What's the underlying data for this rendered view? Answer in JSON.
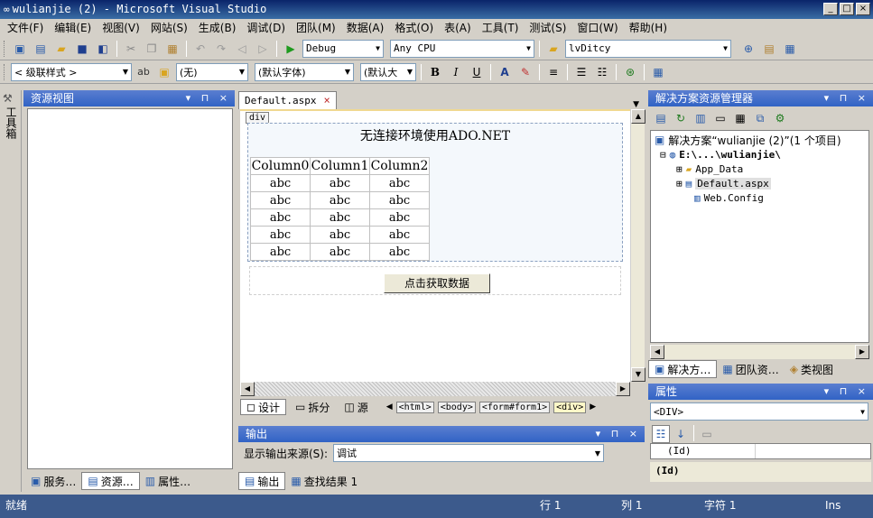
{
  "window": {
    "title": "wulianjie (2) - Microsoft Visual Studio",
    "min": "_",
    "max": "□",
    "close": "×"
  },
  "menu": [
    "文件(F)",
    "编辑(E)",
    "视图(V)",
    "网站(S)",
    "生成(B)",
    "调试(D)",
    "团队(M)",
    "数据(A)",
    "格式(O)",
    "表(A)",
    "工具(T)",
    "测试(S)",
    "窗口(W)",
    "帮助(H)"
  ],
  "toolbar1": {
    "config": "Debug",
    "platform": "Any CPU",
    "search": "lvDitcy"
  },
  "toolbar2": {
    "block_style": "< 级联样式 >",
    "class": "(无)",
    "font": "(默认字体)",
    "size": "(默认大"
  },
  "left_panel": {
    "title": "资源视图",
    "toolbox_label": "工具箱",
    "tabs": [
      "服务…",
      "资源…",
      "属性…"
    ]
  },
  "document": {
    "tab": "Default.aspx",
    "div_tag": "div",
    "heading": "无连接环境使用ADO.NET",
    "columns": [
      "Column0",
      "Column1",
      "Column2"
    ],
    "rows": [
      [
        "abc",
        "abc",
        "abc"
      ],
      [
        "abc",
        "abc",
        "abc"
      ],
      [
        "abc",
        "abc",
        "abc"
      ],
      [
        "abc",
        "abc",
        "abc"
      ],
      [
        "abc",
        "abc",
        "abc"
      ]
    ],
    "button": "点击获取数据",
    "view_tabs": [
      "设计",
      "拆分",
      "源"
    ],
    "crumbs": [
      "<html>",
      "<body>",
      "<form#form1>",
      "<div>"
    ]
  },
  "output": {
    "title": "输出",
    "source_label": "显示输出来源(S):",
    "source_value": "调试",
    "tabs": [
      "输出",
      "查找结果 1"
    ]
  },
  "solution": {
    "title": "解决方案资源管理器",
    "items": [
      "解决方案“wulianjie (2)”(1 个项目)",
      "E:\\...\\wulianjie\\",
      "App_Data",
      "Default.aspx",
      "Web.Config"
    ],
    "tabs": [
      "解决方…",
      "团队资…",
      "类视图"
    ]
  },
  "properties": {
    "title": "属性",
    "object": "<DIV>",
    "row_name": "(Id)",
    "desc": "(Id)"
  },
  "status": {
    "ready": "就绪",
    "line": "行 1",
    "col": "列 1",
    "char": "字符 1",
    "mode": "Ins"
  }
}
